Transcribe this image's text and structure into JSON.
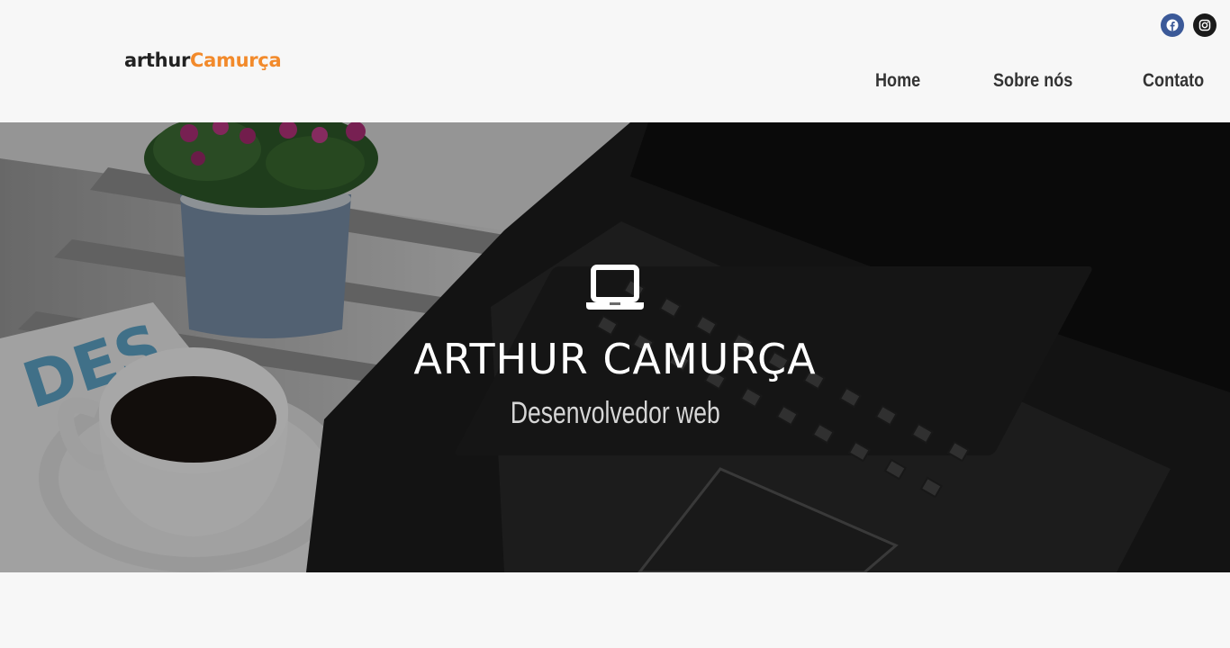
{
  "brand": {
    "logo_part1": "arthur",
    "logo_part2": "Camurça",
    "accent_color": "#f28a2b"
  },
  "social": [
    {
      "name": "facebook",
      "icon": "facebook-icon",
      "color": "#3b5998"
    },
    {
      "name": "instagram",
      "icon": "instagram-icon",
      "color": "#1a1a1a"
    }
  ],
  "nav": {
    "items": [
      "Home",
      "Sobre nós",
      "Contato"
    ]
  },
  "hero": {
    "icon": "laptop-icon",
    "title": "ARTHUR CAMURÇA",
    "subtitle": "Desenvolvedor web",
    "background": "photo: laptop, coffee cup, flower pot on wooden table"
  }
}
